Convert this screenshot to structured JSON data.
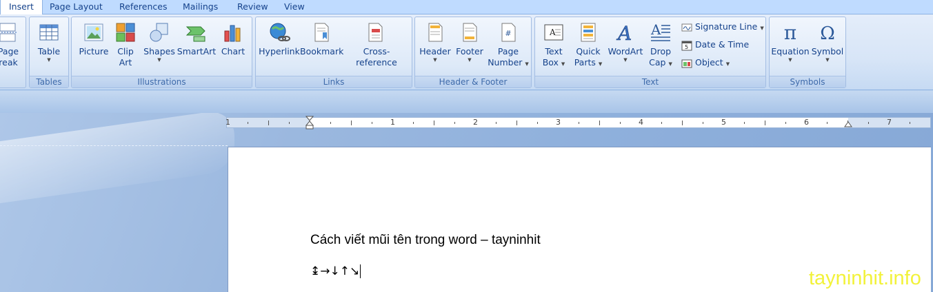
{
  "tabs": {
    "insert": "Insert",
    "page_layout": "Page Layout",
    "references": "References",
    "mailings": "Mailings",
    "review": "Review",
    "view": "View"
  },
  "pages_group": {
    "page_break_line1": "Page",
    "page_break_line2": "reak"
  },
  "tables_group": {
    "label": "Tables",
    "table": "Table"
  },
  "illustrations_group": {
    "label": "Illustrations",
    "picture": "Picture",
    "clip_art_line1": "Clip",
    "clip_art_line2": "Art",
    "shapes": "Shapes",
    "smartart": "SmartArt",
    "chart": "Chart"
  },
  "links_group": {
    "label": "Links",
    "hyperlink": "Hyperlink",
    "bookmark": "Bookmark",
    "cross_reference": "Cross-reference"
  },
  "header_footer_group": {
    "label": "Header & Footer",
    "header": "Header",
    "footer": "Footer",
    "page_number_line1": "Page",
    "page_number_line2": "Number"
  },
  "text_group": {
    "label": "Text",
    "text_box_line1": "Text",
    "text_box_line2": "Box",
    "quick_parts_line1": "Quick",
    "quick_parts_line2": "Parts",
    "wordart": "WordArt",
    "drop_cap_line1": "Drop",
    "drop_cap_line2": "Cap",
    "signature_line": "Signature Line",
    "date_time": "Date & Time",
    "object": "Object"
  },
  "symbols_group": {
    "label": "Symbols",
    "equation": "Equation",
    "symbol": "Symbol"
  },
  "ruler": {
    "numbers": [
      "1",
      "1",
      "2",
      "3",
      "4",
      "5",
      "6",
      "7"
    ]
  },
  "document": {
    "line1": "Cách viết mũi tên trong word – tayninhit",
    "line2": "↨→↓↑↘"
  },
  "watermark": "tayninhit.info",
  "colors": {
    "ribbon_text": "#15428b",
    "tab_bar": "#bfdbff",
    "workspace": "#8fb0dc",
    "watermark": "#f2f230"
  }
}
